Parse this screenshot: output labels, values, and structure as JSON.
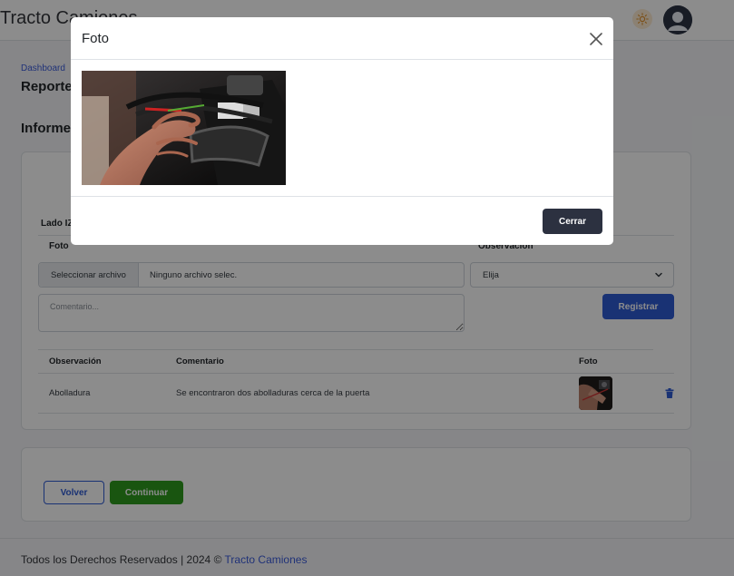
{
  "header": {
    "brand": "Tracto Camiones",
    "theme_icon": "sun-icon",
    "avatar_icon": "user-avatar-icon"
  },
  "page": {
    "breadcrumb": "Dashboard",
    "title": "Reporte",
    "section_title": "Informe"
  },
  "form": {
    "side_label": "Lado IZ",
    "photo_label": "Foto",
    "observation_label": "Observación",
    "file_button_label": "Seleccionar archivo",
    "file_name": "Ninguno archivo selec.",
    "select_value": "Elija",
    "comment_placeholder": "Comentario...",
    "register_label": "Registrar"
  },
  "table": {
    "headers": [
      "Observación",
      "Comentario",
      "Foto"
    ],
    "rows": [
      {
        "observation": "Abolladura",
        "comment": "Se encontraron dos abolladuras cerca de la puerta"
      }
    ]
  },
  "actions": {
    "back_label": "Volver",
    "continue_label": "Continuar"
  },
  "footer": {
    "text": "Todos los Derechos Reservados  | 2024 © ",
    "link": "Tracto Camiones"
  },
  "modal": {
    "title": "Foto",
    "close_label": "Cerrar"
  },
  "colors": {
    "primary": "#2f5bd3",
    "success": "#2e9b1e",
    "dark": "#2c3140"
  }
}
